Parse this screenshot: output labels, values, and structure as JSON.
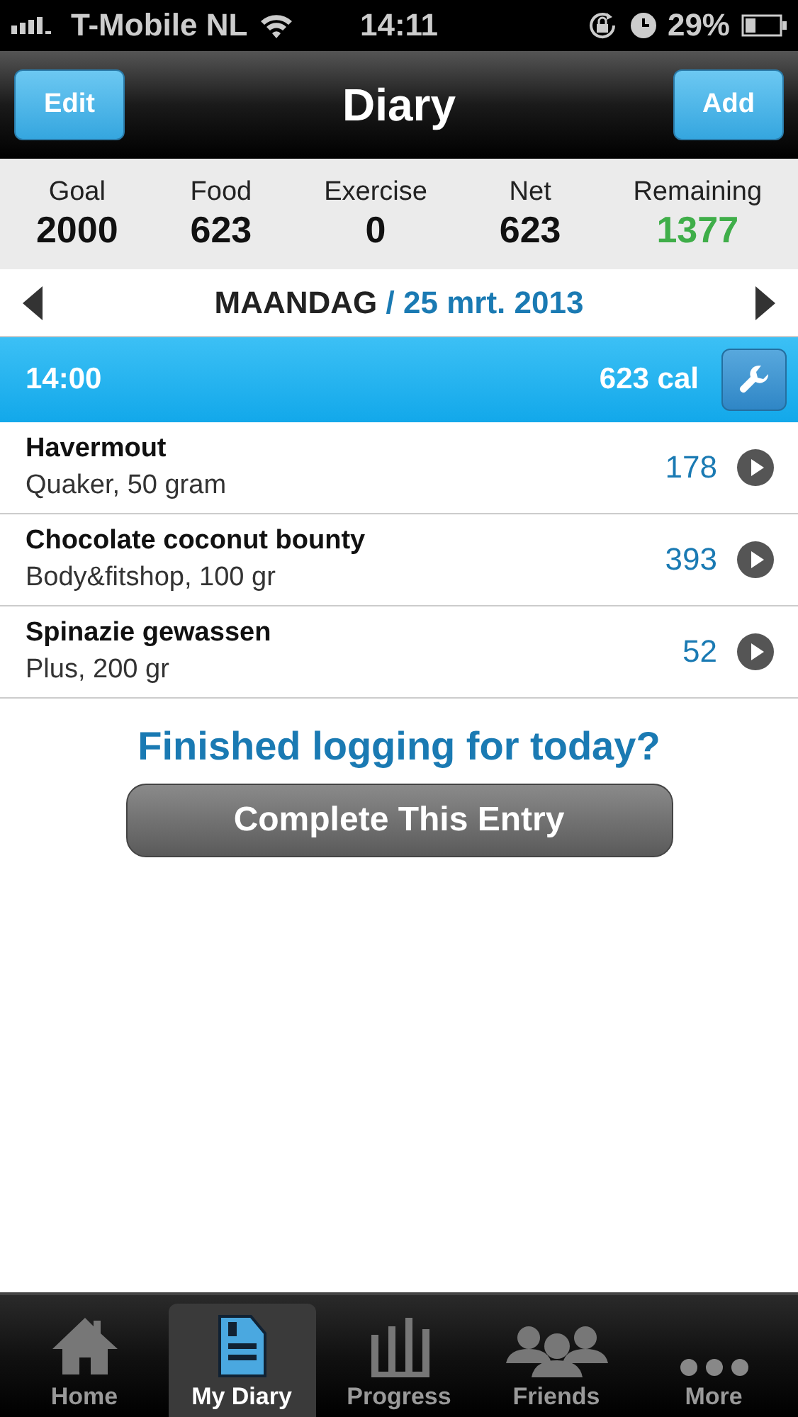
{
  "status_bar": {
    "carrier": "T-Mobile NL",
    "time": "14:11",
    "battery": "29%"
  },
  "nav": {
    "left_button": "Edit",
    "title": "Diary",
    "right_button": "Add"
  },
  "summary": [
    {
      "label": "Goal",
      "value": "2000",
      "color": "#111111"
    },
    {
      "label": "Food",
      "value": "623",
      "color": "#111111"
    },
    {
      "label": "Exercise",
      "value": "0",
      "color": "#111111"
    },
    {
      "label": "Net",
      "value": "623",
      "color": "#111111"
    },
    {
      "label": "Remaining",
      "value": "1377",
      "color": "#3fae49"
    }
  ],
  "date": {
    "day": "MAANDAG",
    "date": "/ 25 mrt. 2013"
  },
  "meal": {
    "time": "14:00",
    "calories": "623 cal"
  },
  "entries": [
    {
      "name": "Havermout",
      "detail": "Quaker, 50 gram",
      "calories": "178"
    },
    {
      "name": "Chocolate coconut bounty",
      "detail": "Body&fitshop, 100 gr",
      "calories": "393"
    },
    {
      "name": "Spinazie gewassen",
      "detail": "Plus, 200 gr",
      "calories": "52"
    }
  ],
  "prompt": "Finished logging for today?",
  "complete_button": "Complete This Entry",
  "tabs": [
    {
      "label": "Home",
      "kind": "home",
      "selected": false
    },
    {
      "label": "My Diary",
      "kind": "diary",
      "selected": true
    },
    {
      "label": "Progress",
      "kind": "progress",
      "selected": false
    },
    {
      "label": "Friends",
      "kind": "friends",
      "selected": false
    },
    {
      "label": "More",
      "kind": "more",
      "selected": false
    }
  ]
}
